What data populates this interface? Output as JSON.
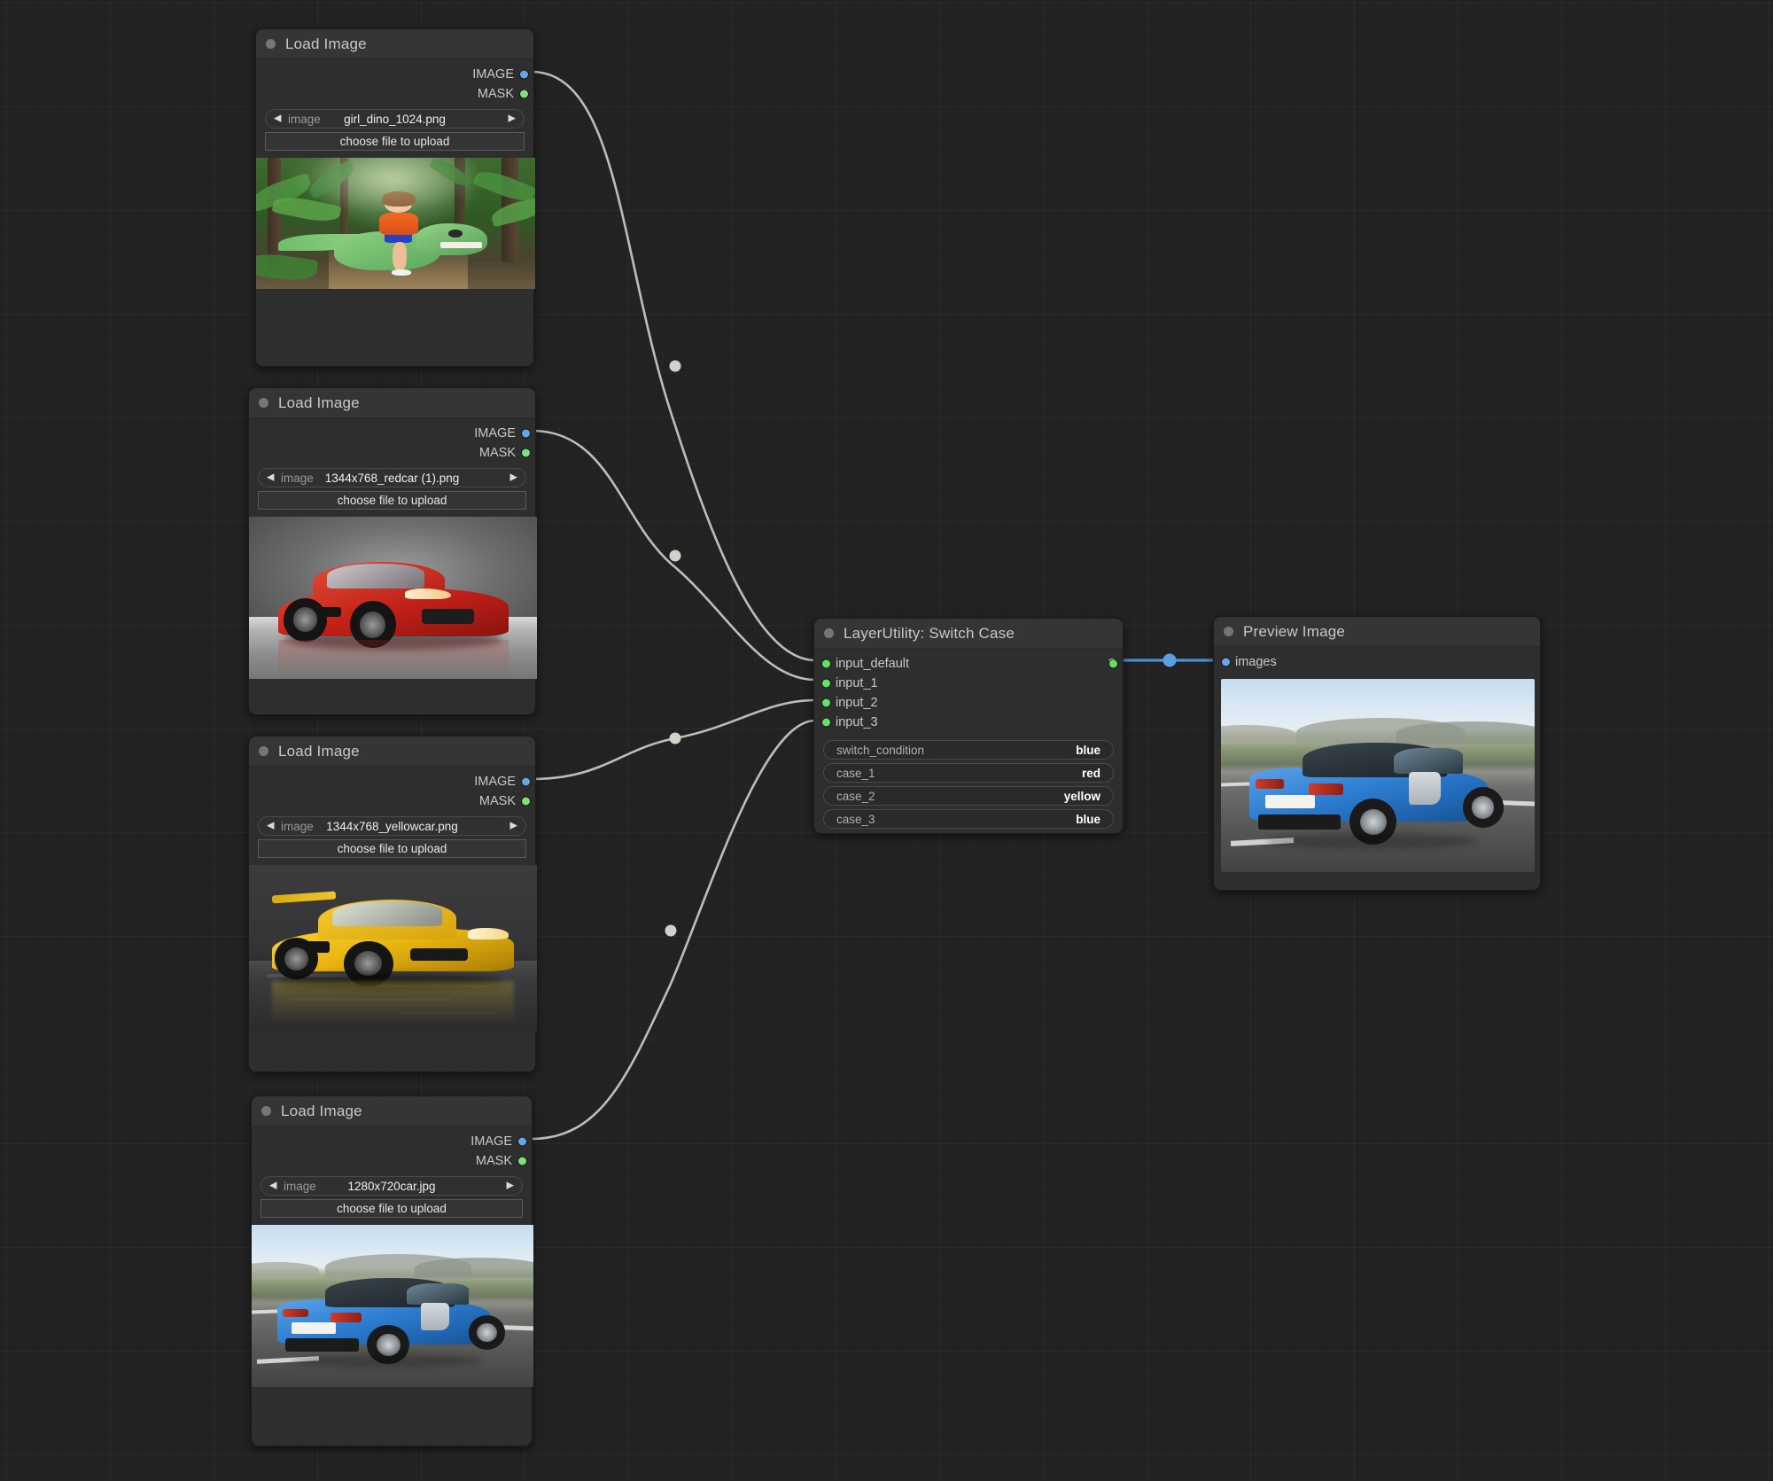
{
  "app": {
    "canvas_background": "#222222",
    "link_color_default": "#b8c2b4",
    "link_color_image": "#4d8fd6"
  },
  "nodes": [
    {
      "id": "load_image_1",
      "title": "Load Image",
      "outputs": [
        {
          "name": "IMAGE",
          "type": "IMAGE"
        },
        {
          "name": "MASK",
          "type": "MASK"
        }
      ],
      "widgets": {
        "image_label": "image",
        "image_value": "girl_dino_1024.png",
        "upload_label": "choose file to upload"
      },
      "preview_alt": "girl riding dinosaur in jungle"
    },
    {
      "id": "load_image_2",
      "title": "Load Image",
      "outputs": [
        {
          "name": "IMAGE",
          "type": "IMAGE"
        },
        {
          "name": "MASK",
          "type": "MASK"
        }
      ],
      "widgets": {
        "image_label": "image",
        "image_value": "1344x768_redcar (1).png",
        "upload_label": "choose file to upload"
      },
      "preview_alt": "red sports car in studio"
    },
    {
      "id": "load_image_3",
      "title": "Load Image",
      "outputs": [
        {
          "name": "IMAGE",
          "type": "IMAGE"
        },
        {
          "name": "MASK",
          "type": "MASK"
        }
      ],
      "widgets": {
        "image_label": "image",
        "image_value": "1344x768_yellowcar.png",
        "upload_label": "choose file to upload"
      },
      "preview_alt": "yellow sports car on wet floor"
    },
    {
      "id": "load_image_4",
      "title": "Load Image",
      "outputs": [
        {
          "name": "IMAGE",
          "type": "IMAGE"
        },
        {
          "name": "MASK",
          "type": "MASK"
        }
      ],
      "widgets": {
        "image_label": "image",
        "image_value": "1280x720car.jpg",
        "upload_label": "choose file to upload"
      },
      "preview_alt": "blue audi r8 on road"
    },
    {
      "id": "switch_case",
      "title": "LayerUtility: Switch Case",
      "inputs": [
        {
          "name": "input_default",
          "type": "*"
        },
        {
          "name": "input_1",
          "type": "*"
        },
        {
          "name": "input_2",
          "type": "*"
        },
        {
          "name": "input_3",
          "type": "*"
        }
      ],
      "outputs": [
        {
          "name": "?",
          "type": "*"
        }
      ],
      "widgets": [
        {
          "label": "switch_condition",
          "value": "blue"
        },
        {
          "label": "case_1",
          "value": "red"
        },
        {
          "label": "case_2",
          "value": "yellow"
        },
        {
          "label": "case_3",
          "value": "blue"
        }
      ]
    },
    {
      "id": "preview_image",
      "title": "Preview Image",
      "inputs": [
        {
          "name": "images",
          "type": "IMAGE"
        }
      ],
      "preview_alt": "blue audi r8 on road"
    }
  ]
}
